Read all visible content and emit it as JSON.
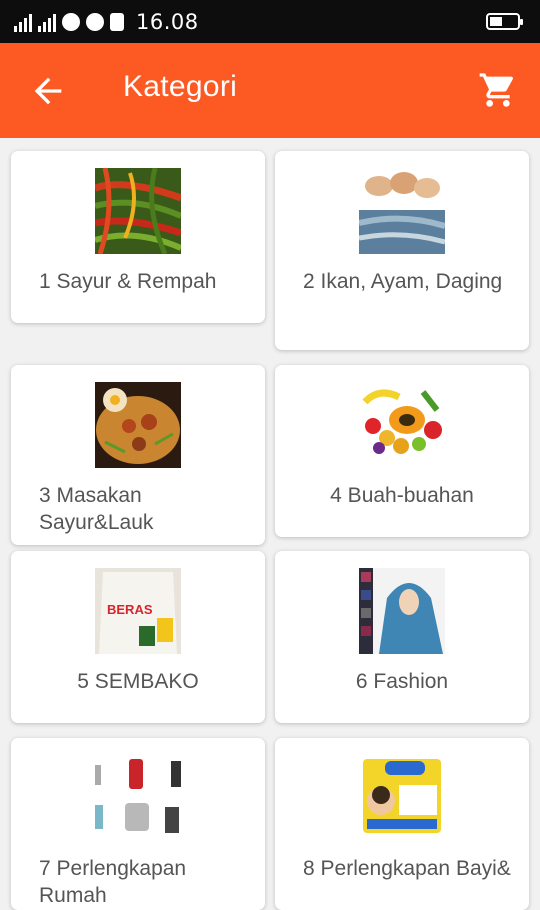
{
  "status_bar": {
    "time": "16.08"
  },
  "app_bar": {
    "title": "Kategori",
    "back_icon": "arrow-left-icon",
    "cart_icon": "shopping-cart-icon",
    "background": "#fc5a22"
  },
  "categories": [
    {
      "label": "1 Sayur & Rempah",
      "image": "chili-peppers"
    },
    {
      "label": "2 Ikan, Ayam, Daging",
      "image": "fish-and-chicken"
    },
    {
      "label": "3 Masakan Sayur&Lauk",
      "image": "cooked-dish"
    },
    {
      "label": "4 Buah-buahan",
      "image": "fruit-assortment"
    },
    {
      "label": "5 SEMBAKO",
      "image": "rice-sack",
      "image_text": "BERAS"
    },
    {
      "label": "6 Fashion",
      "image": "hijab-model"
    },
    {
      "label": "7 Perlengkapan Rumah",
      "image": "home-appliances"
    },
    {
      "label": "8 Perlengkapan Bayi&",
      "image": "baby-diapers"
    }
  ]
}
